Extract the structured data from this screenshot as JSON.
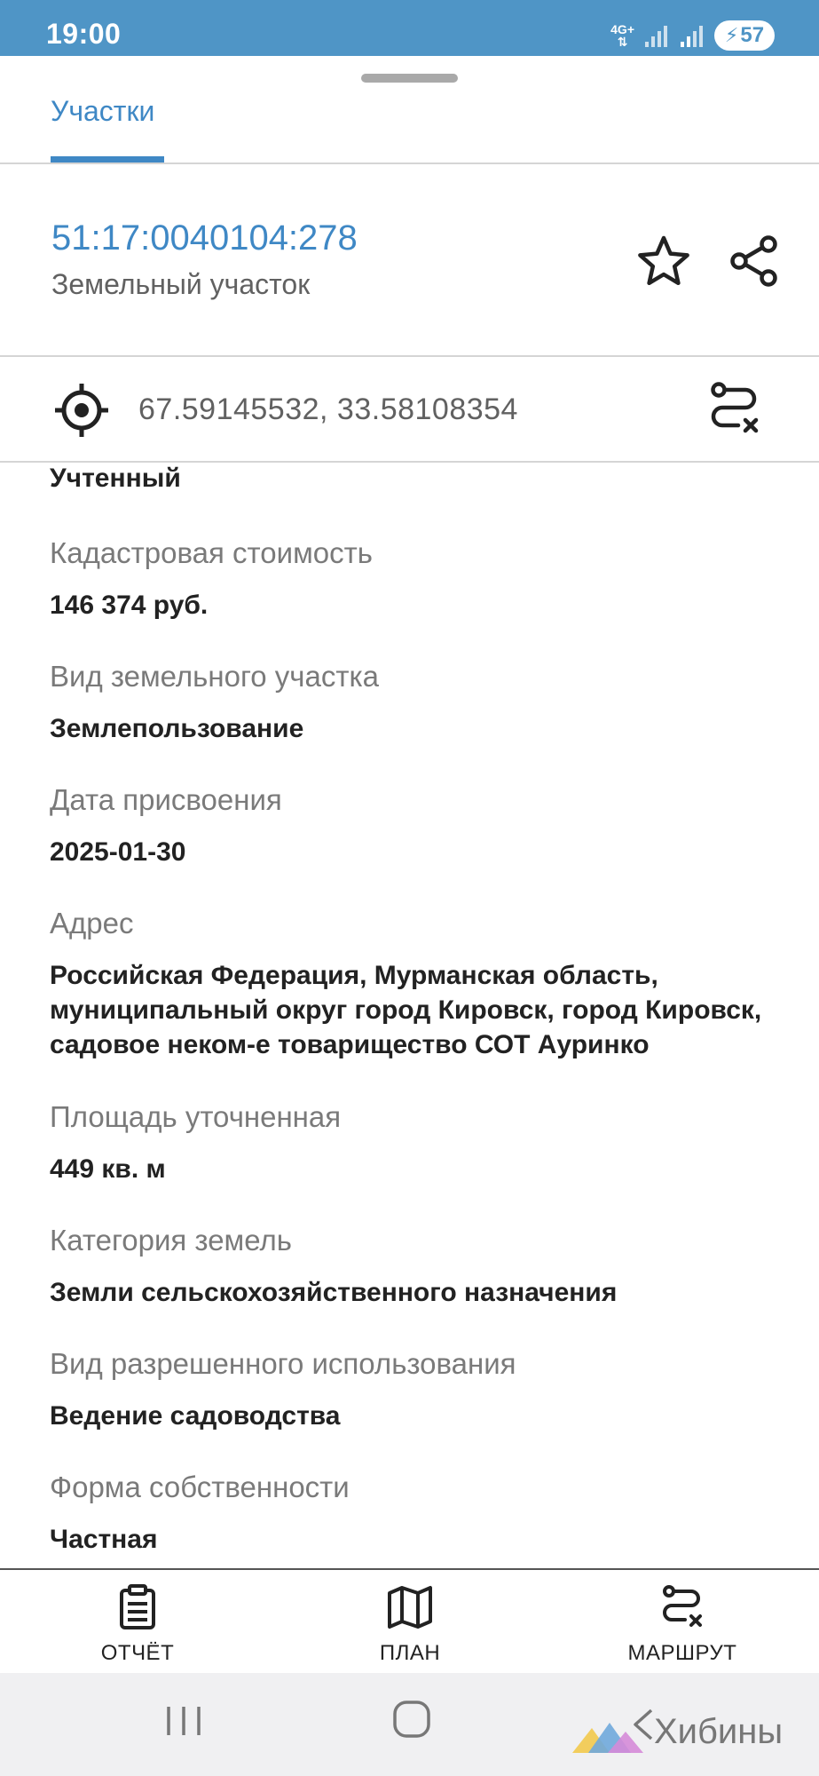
{
  "status_bar": {
    "time": "19:00",
    "network": "4G+",
    "battery": "57"
  },
  "tabs": {
    "active": "Участки"
  },
  "parcel": {
    "cadastral_number": "51:17:0040104:278",
    "type": "Земельный участок"
  },
  "coords": {
    "text": "67.59145532, 33.58108354"
  },
  "details": {
    "status_value": "Учтенный",
    "fields": [
      {
        "label": "Кадастровая стоимость",
        "value": "146 374 руб."
      },
      {
        "label": "Вид земельного участка",
        "value": "Землепользование"
      },
      {
        "label": "Дата присвоения",
        "value": "2025-01-30"
      },
      {
        "label": "Адрес",
        "value": "Российская Федерация, Мурманская область, муниципальный округ город Кировск, город Кировск, садовое неком-е товарищество СОТ Ауринко"
      },
      {
        "label": "Площадь уточненная",
        "value": "449 кв. м"
      },
      {
        "label": "Категория земель",
        "value": "Земли сельскохозяйственного назначения"
      },
      {
        "label": "Вид разрешенного использования",
        "value": "Ведение садоводства"
      },
      {
        "label": "Форма собственности",
        "value": "Частная"
      }
    ]
  },
  "bottom_nav": {
    "report": "ОТЧЁТ",
    "plan": "ПЛАН",
    "route": "МАРШРУТ"
  },
  "watermark": "Хибины",
  "colors": {
    "accent": "#3f88c5",
    "status_bar": "#4f95c6"
  }
}
